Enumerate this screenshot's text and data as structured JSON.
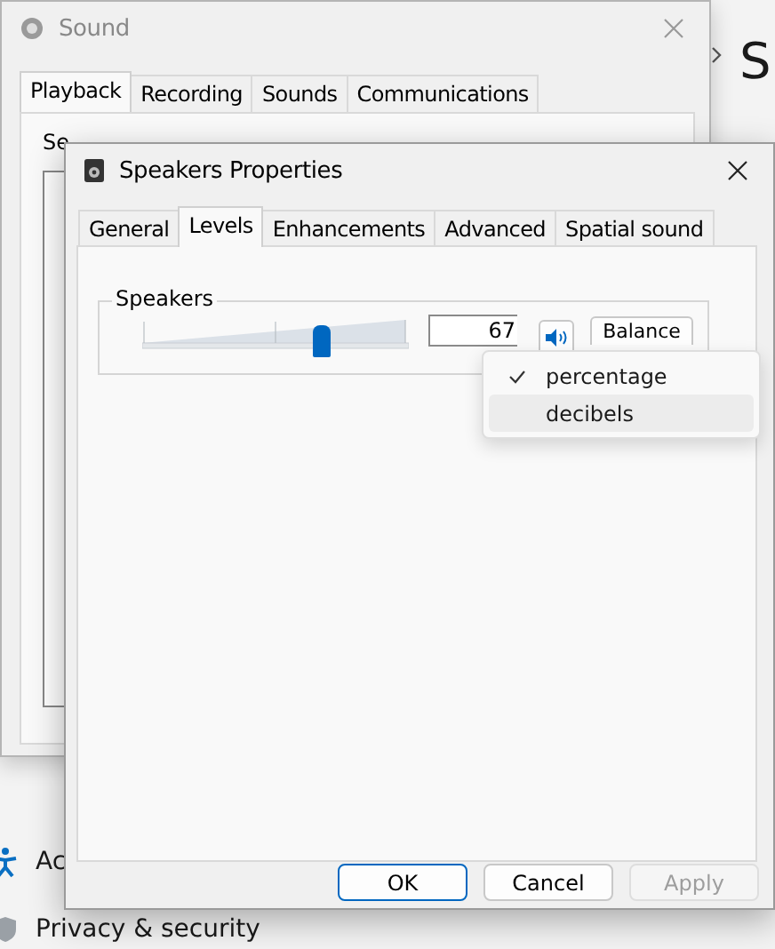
{
  "settings_window": {
    "heading": "S",
    "items": [
      {
        "label": "Ac"
      },
      {
        "label": "Privacy & security"
      }
    ]
  },
  "sound_window": {
    "title": "Sound",
    "instruction": "Se",
    "tabs": [
      {
        "label": "Playback",
        "selected": true
      },
      {
        "label": "Recording",
        "selected": false
      },
      {
        "label": "Sounds",
        "selected": false
      },
      {
        "label": "Communications",
        "selected": false
      }
    ]
  },
  "properties_dialog": {
    "title": "Speakers Properties",
    "tabs": [
      {
        "label": "General",
        "selected": false
      },
      {
        "label": "Levels",
        "selected": true
      },
      {
        "label": "Enhancements",
        "selected": false
      },
      {
        "label": "Advanced",
        "selected": false
      },
      {
        "label": "Spatial sound",
        "selected": false
      }
    ],
    "group": {
      "label": "Speakers",
      "level": 0.67,
      "value": "67",
      "balance": "Balance"
    },
    "unit_menu": [
      {
        "label": "percentage",
        "checked": true,
        "selected": false
      },
      {
        "label": "decibels",
        "checked": false,
        "selected": true
      }
    ],
    "buttons": [
      {
        "label": "OK",
        "default": true,
        "disabled": false
      },
      {
        "label": "Cancel",
        "default": false,
        "disabled": false
      },
      {
        "label": "Apply",
        "default": false,
        "disabled": true
      }
    ]
  }
}
